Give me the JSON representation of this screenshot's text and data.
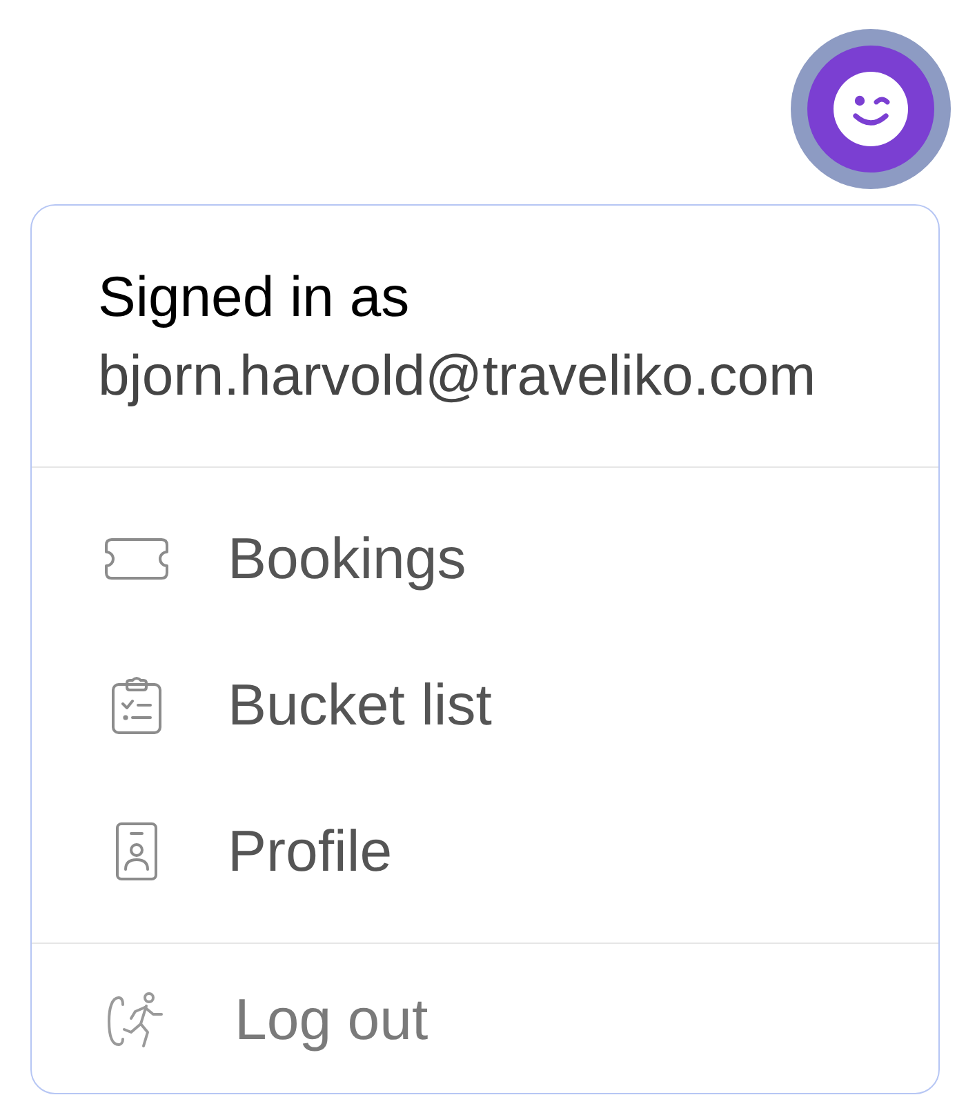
{
  "account_menu": {
    "header": {
      "label": "Signed in as",
      "email": "bjorn.harvold@traveliko.com"
    },
    "sections": [
      {
        "items": [
          {
            "label": "Bookings",
            "kind": "ticket"
          },
          {
            "label": "Bucket list",
            "kind": "checklist"
          },
          {
            "label": "Profile",
            "kind": "badge"
          }
        ]
      },
      {
        "items": [
          {
            "label": "Log out",
            "kind": "logout"
          }
        ]
      }
    ]
  }
}
